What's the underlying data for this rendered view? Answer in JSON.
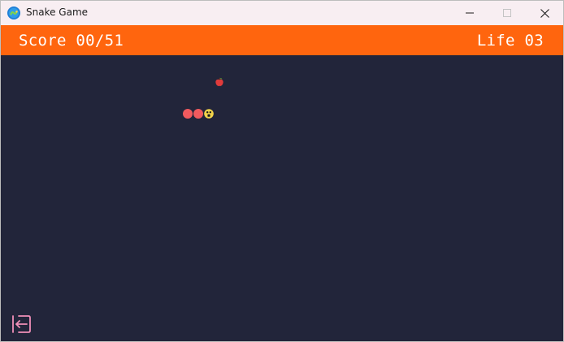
{
  "window": {
    "title": "Snake Game",
    "app_icon": "snake-app-icon",
    "controls": [
      "minimize-icon",
      "maximize-icon",
      "close-icon"
    ]
  },
  "hud": {
    "score_text": "Score 00/51",
    "life_text": "Life 03",
    "background_color": "#ff650e"
  },
  "game": {
    "field_color": "#22253a",
    "snake_body_color": "#f05a5e",
    "snake_head_color": "#f2d44a",
    "snake_length": 3,
    "food": "apple-icon"
  },
  "controls": {
    "exit_icon": "exit-icon"
  }
}
